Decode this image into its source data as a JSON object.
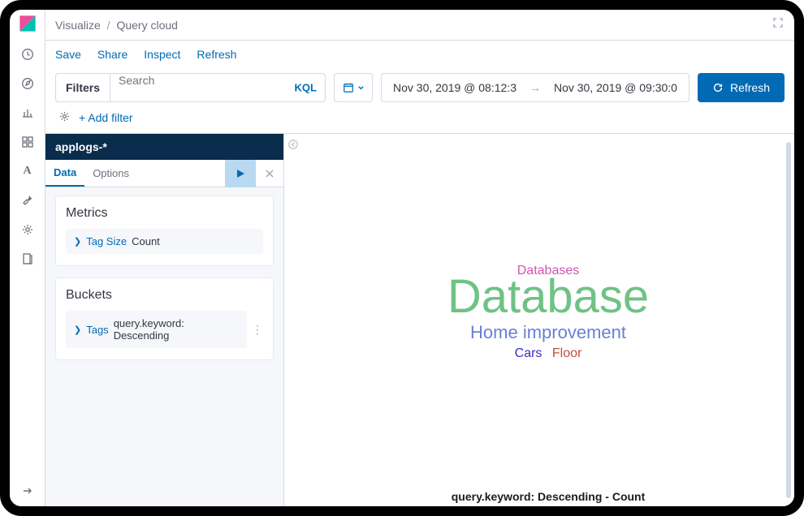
{
  "breadcrumb": {
    "root": "Visualize",
    "current": "Query cloud"
  },
  "tabs": {
    "save": "Save",
    "share": "Share",
    "inspect": "Inspect",
    "refresh": "Refresh"
  },
  "filterbar": {
    "filters_label": "Filters",
    "search_placeholder": "Search",
    "kql": "KQL",
    "time_from": "Nov 30, 2019 @ 08:12:3",
    "time_to": "Nov 30, 2019 @ 09:30:0",
    "refresh_btn": "Refresh"
  },
  "addfilter": {
    "label": "+ Add filter"
  },
  "sidepanel": {
    "index_pattern": "applogs-*",
    "tabs": {
      "data": "Data",
      "options": "Options"
    },
    "metrics": {
      "title": "Metrics",
      "item_label": "Tag Size",
      "item_value": "Count"
    },
    "buckets": {
      "title": "Buckets",
      "item_label": "Tags",
      "item_value": "query.keyword: Descending"
    }
  },
  "cloud": {
    "w1": "Databases",
    "w2": "Database",
    "w3": "Home improvement",
    "w4": "Cars",
    "w5": "Floor"
  },
  "canvas_footer": "query.keyword: Descending - Count",
  "chart_data": {
    "type": "wordcloud",
    "metric": "Tag Size: Count",
    "bucket": "Tags: query.keyword Descending",
    "words": [
      {
        "text": "Database",
        "weight": 5,
        "color": "#6fc284"
      },
      {
        "text": "Home improvement",
        "weight": 3,
        "color": "#6a7fd6"
      },
      {
        "text": "Databases",
        "weight": 2,
        "color": "#d354b3"
      },
      {
        "text": "Cars",
        "weight": 2,
        "color": "#3a2bbf"
      },
      {
        "text": "Floor",
        "weight": 2,
        "color": "#c74b3a"
      }
    ],
    "legend": "query.keyword: Descending - Count"
  }
}
